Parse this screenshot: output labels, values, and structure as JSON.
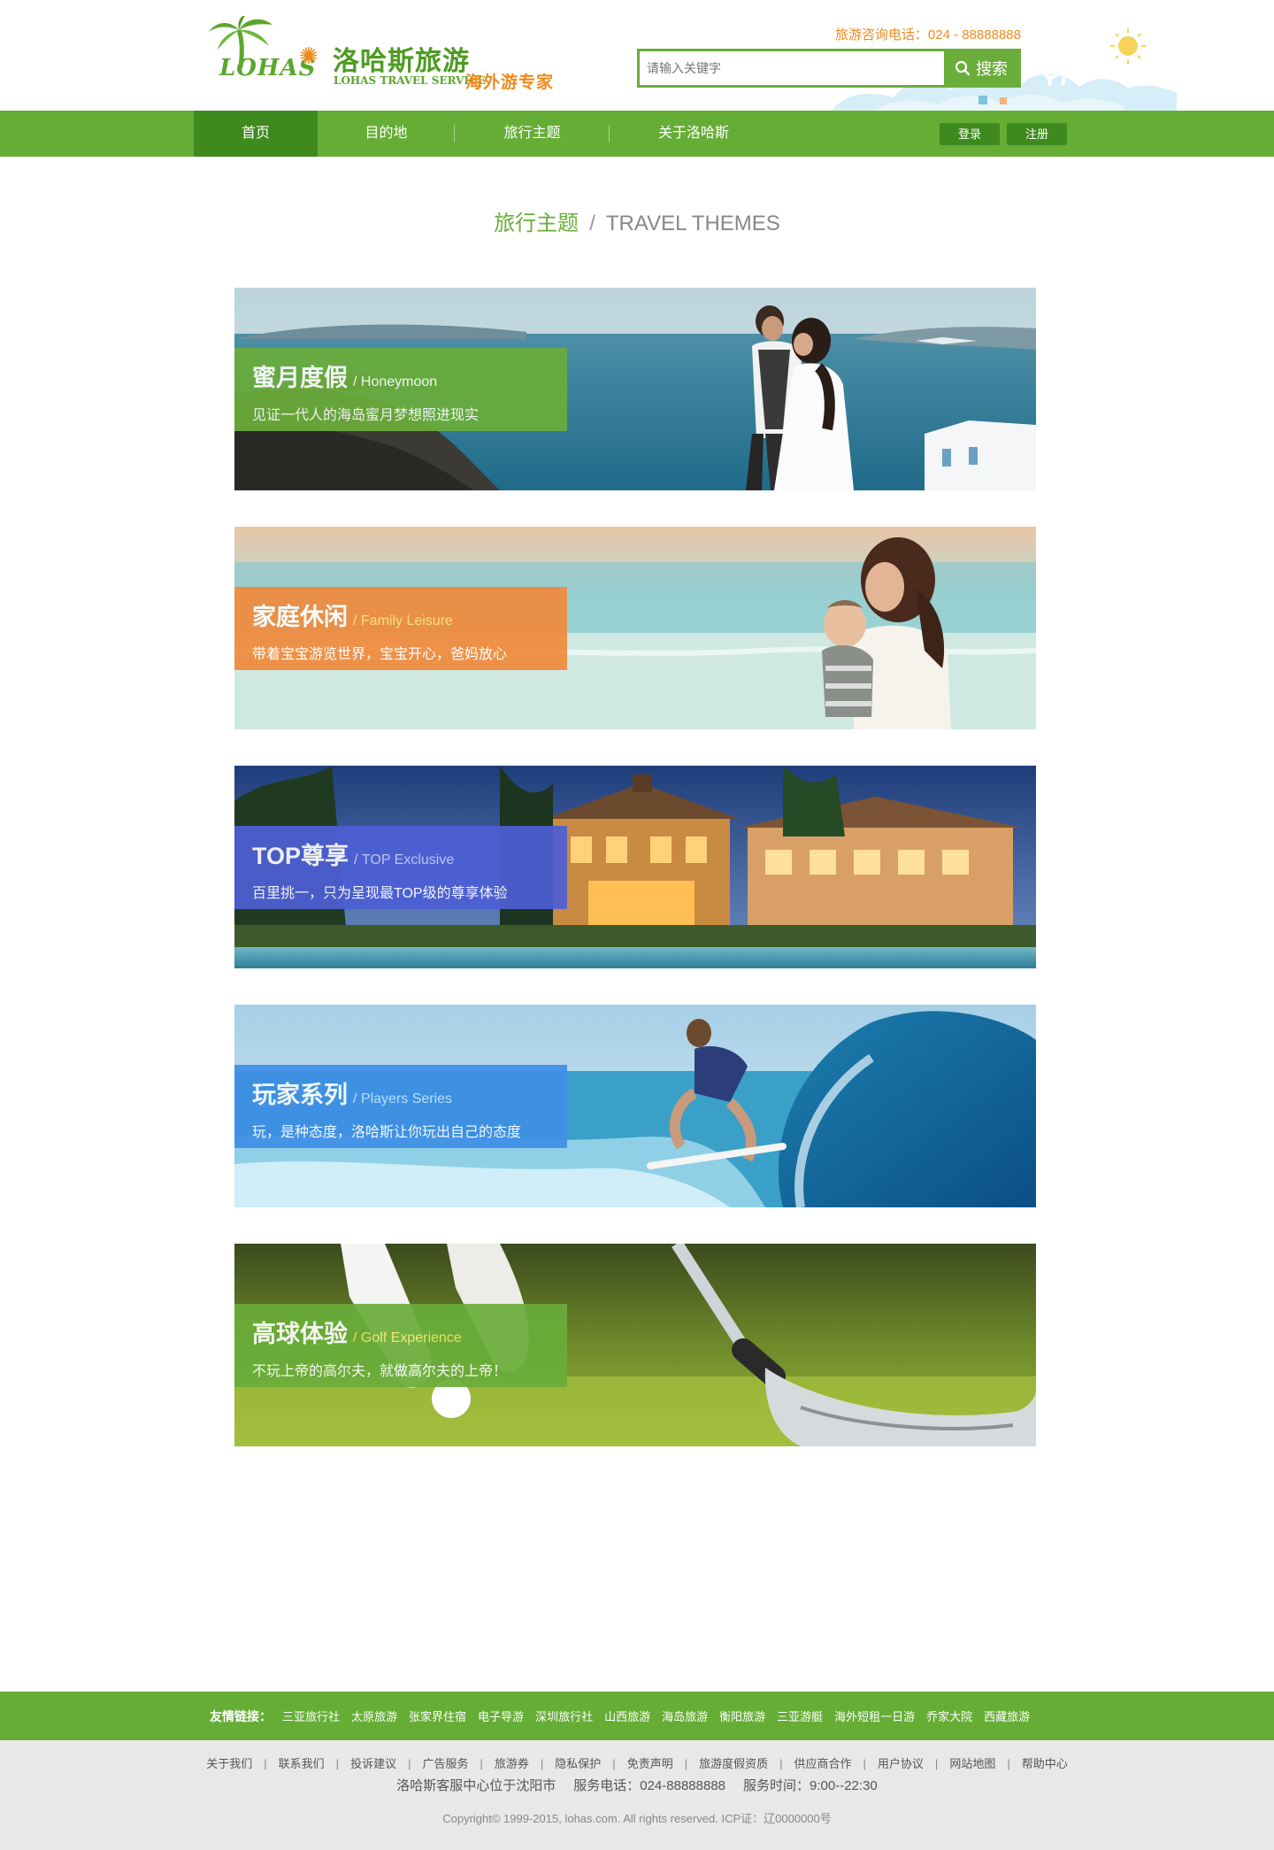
{
  "header": {
    "logo_text": "LOHAS",
    "brand_cn": "洛哈斯旅游",
    "brand_en": "LOHAS TRAVEL SERVICE",
    "slogan": "海外游专家",
    "hotline": "旅游咨询电话：024 - 88888888",
    "search_placeholder": "请输入关键字",
    "search_button": "搜索"
  },
  "nav": {
    "items": [
      {
        "label": "首页",
        "active": true
      },
      {
        "label": "目的地",
        "active": false
      },
      {
        "label": "旅行主题",
        "active": false
      },
      {
        "label": "关于洛哈斯",
        "active": false
      }
    ],
    "login": "登录",
    "register": "注册"
  },
  "section": {
    "title_cn": "旅行主题",
    "separator": "/",
    "title_en": "TRAVEL THEMES"
  },
  "themes": [
    {
      "title": "蜜月度假",
      "subtitle": "/ Honeymoon",
      "desc": "见证一代人的海岛蜜月梦想照进现实",
      "label_color": "#6aad3a",
      "sub_color": "#ffffff"
    },
    {
      "title": "家庭休闲",
      "subtitle": "/ Family Leisure",
      "desc": "带着宝宝游览世界，宝宝开心，爸妈放心",
      "label_color": "#f08a3c",
      "sub_color": "#ffe36b"
    },
    {
      "title": "TOP尊享",
      "subtitle": "/ TOP Exclusive",
      "desc": "百里挑一，只为呈现最TOP级的尊享体验",
      "label_color": "#4d5fd6",
      "sub_color": "#c7cdf5"
    },
    {
      "title": "玩家系列",
      "subtitle": "/ Players Series",
      "desc": "玩，是种态度，洛哈斯让你玩出自己的态度",
      "label_color": "#3f8fe6",
      "sub_color": "#bfe4ff"
    },
    {
      "title": "高球体验",
      "subtitle": "/ Golf Experience",
      "desc": "不玩上帝的高尔夫，就做高尔夫的上帝！",
      "label_color": "#6aad3a",
      "sub_color": "#f5e66a"
    }
  ],
  "links": {
    "title": "友情链接：",
    "items": [
      "三亚旅行社",
      "太原旅游",
      "张家界住宿",
      "电子导游",
      "深圳旅行社",
      "山西旅游",
      "海岛旅游",
      "衡阳旅游",
      "三亚游艇",
      "海外短租一日游",
      "乔家大院",
      "西藏旅游"
    ]
  },
  "footer": {
    "nav": [
      "关于我们",
      "联系我们",
      "投诉建议",
      "广告服务",
      "旅游券",
      "隐私保护",
      "免责声明",
      "旅游度假资质",
      "供应商合作",
      "用户协议",
      "网站地图",
      "帮助中心"
    ],
    "center": "洛哈斯客服中心位于沈阳市",
    "phone": "服务电话：024-88888888",
    "hours": "服务时间：9:00--22:30",
    "copyright": "Copyright© 1999-2015, lohas.com. All rights reserved.  ICP证：辽0000000号"
  },
  "colors": {
    "brand_green": "#66ad36",
    "brand_dark_green": "#3f8a1e",
    "brand_orange": "#f08a1c"
  }
}
